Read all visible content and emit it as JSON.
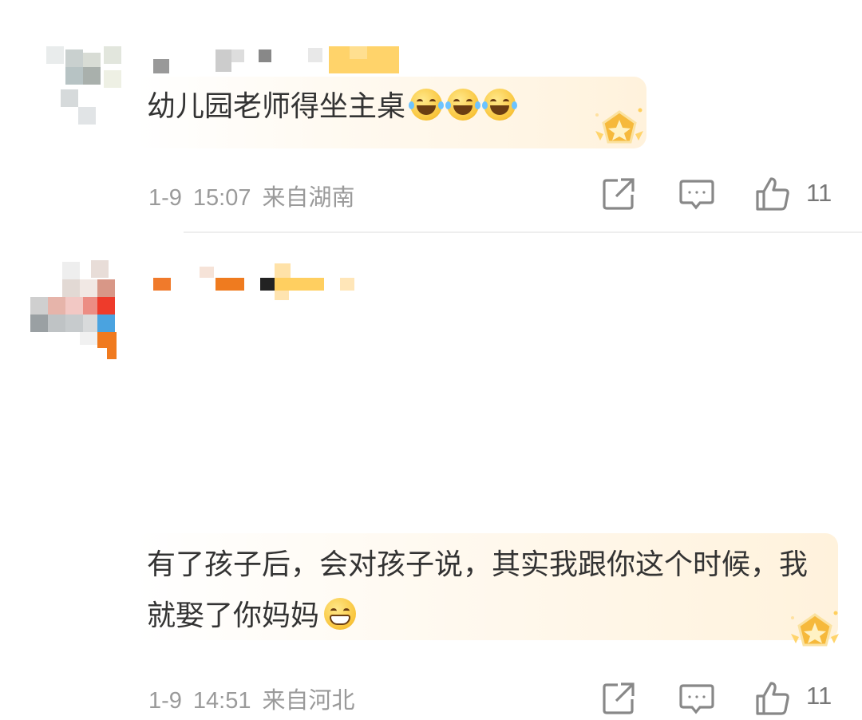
{
  "comments": [
    {
      "text": "幼儿园老师得坐主桌",
      "emoji": [
        "laugh-cry",
        "laugh-cry",
        "laugh-cry"
      ],
      "date": "1-9",
      "time": "15:07",
      "location": "来自湖南",
      "likes": "11"
    },
    {
      "text": "有了孩子后，会对孩子说，其实我跟你这个时候，我就娶了你妈妈",
      "emoji": [
        "grin"
      ],
      "date": "1-9",
      "time": "14:51",
      "location": "来自河北",
      "likes": "11"
    }
  ],
  "icons": {
    "share": "share-icon",
    "reply": "comment-icon",
    "like": "thumbs-up-icon",
    "badge": "star-medal-icon"
  },
  "colors": {
    "text": "#333333",
    "meta": "#9a9a9a",
    "bubble": "#fff2dc",
    "badge": "#f6b93b"
  }
}
